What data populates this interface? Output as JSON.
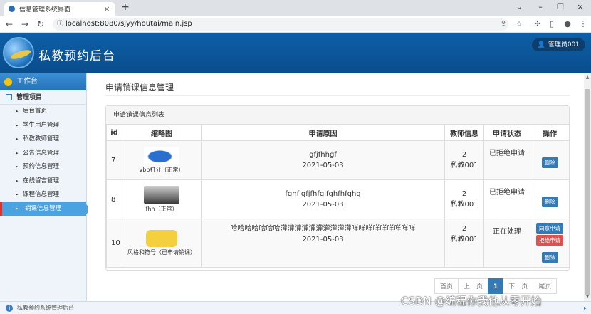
{
  "browser": {
    "tab_title": "信息管理系统界面",
    "url": "localhost:8080/sjyy/houtai/main.jsp"
  },
  "header": {
    "app_title": "私教预约后台",
    "user_label": "管理员001"
  },
  "sidebar": {
    "head": "工作台",
    "group": "管理项目",
    "items": [
      {
        "label": "后台首页"
      },
      {
        "label": "学生用户管理"
      },
      {
        "label": "私教教师管理"
      },
      {
        "label": "公告信息管理"
      },
      {
        "label": "预约信息管理"
      },
      {
        "label": "在线留言管理"
      },
      {
        "label": "课程信息管理"
      },
      {
        "label": "销课信息管理"
      }
    ]
  },
  "main": {
    "page_title": "申请销课信息管理",
    "panel_title": "申请销课信息列表",
    "columns": [
      "id",
      "缩略图",
      "申请原因",
      "教师信息",
      "申请状态",
      "操作"
    ],
    "rows": [
      {
        "id": "7",
        "thumb_caption": "vbb打分（正常）",
        "reason": "gfjfhhgf",
        "date": "2021-05-03",
        "teacher_num": "2",
        "teacher_name": "私教001",
        "status": "已拒绝申请",
        "delete_label": "删除"
      },
      {
        "id": "8",
        "thumb_caption": "fhh（正常）",
        "reason": "fgnfjgfjfhfgjfghfhfghg",
        "date": "2021-05-03",
        "teacher_num": "2",
        "teacher_name": "私教001",
        "status": "已拒绝申请",
        "delete_label": "删除"
      },
      {
        "id": "10",
        "thumb_caption": "风格和符号（已申请销课）",
        "reason": "哈哈哈哈哈哈哈灌灌灌灌灌灌灌灌灌灌咩咩咩咩咩咩咩咩咩",
        "date": "2021-05-03",
        "teacher_num": "2",
        "teacher_name": "私教001",
        "status": "正在处理",
        "agree_label": "同意申请",
        "reject_label": "拒绝申请",
        "delete_label": "删除"
      }
    ],
    "pagination": {
      "first": "首页",
      "prev": "上一页",
      "current": "1",
      "next": "下一页",
      "last": "尾页"
    }
  },
  "footer": {
    "text": "私教预约系统管理后台"
  },
  "watermark": "CSDN @编程你我他从零开始",
  "colors": {
    "header_blue": "#0d5fa8",
    "active_item": "#4aa3e0",
    "button_blue": "#337ab7",
    "button_red": "#d9534f"
  }
}
